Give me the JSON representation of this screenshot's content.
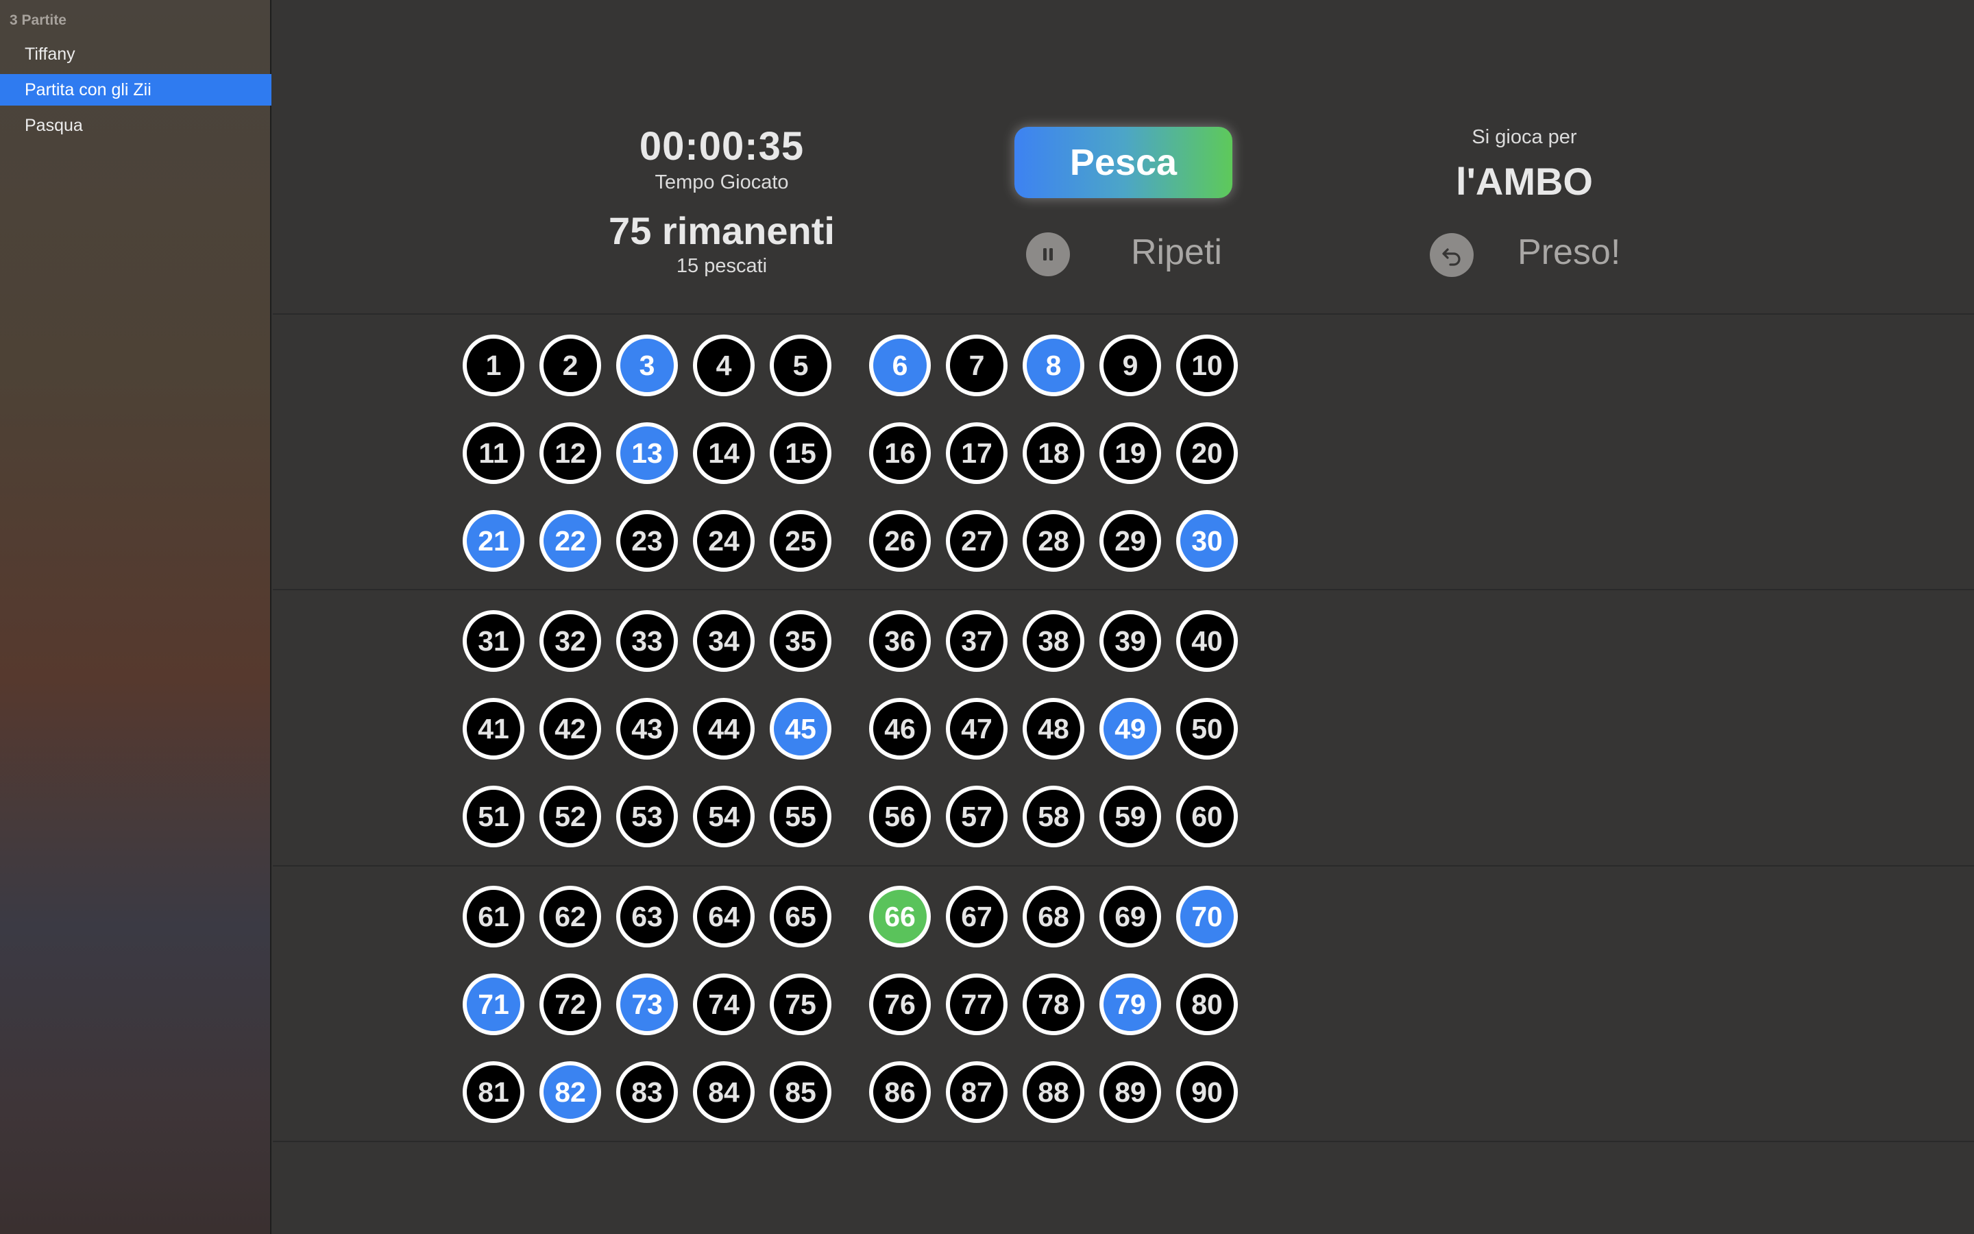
{
  "sidebar": {
    "header": "3 Partite",
    "items": [
      {
        "label": "Tiffany",
        "selected": false
      },
      {
        "label": "Partita con gli Zii",
        "selected": true
      },
      {
        "label": "Pasqua",
        "selected": false
      }
    ]
  },
  "stats": {
    "time_played": "00:00:35",
    "time_label": "Tempo Giocato",
    "remaining": "75 rimanenti",
    "drawn": "15 pescati"
  },
  "controls": {
    "draw_label": "Pesca",
    "repeat_label": "Ripeti",
    "pause_icon": "pause-icon",
    "undo_icon": "undo-icon",
    "taken_label": "Preso!"
  },
  "goal": {
    "label": "Si gioca per",
    "value": "l'AMBO"
  },
  "board": {
    "numbers": [
      1,
      2,
      3,
      4,
      5,
      6,
      7,
      8,
      9,
      10,
      11,
      12,
      13,
      14,
      15,
      16,
      17,
      18,
      19,
      20,
      21,
      22,
      23,
      24,
      25,
      26,
      27,
      28,
      29,
      30,
      31,
      32,
      33,
      34,
      35,
      36,
      37,
      38,
      39,
      40,
      41,
      42,
      43,
      44,
      45,
      46,
      47,
      48,
      49,
      50,
      51,
      52,
      53,
      54,
      55,
      56,
      57,
      58,
      59,
      60,
      61,
      62,
      63,
      64,
      65,
      66,
      67,
      68,
      69,
      70,
      71,
      72,
      73,
      74,
      75,
      76,
      77,
      78,
      79,
      80,
      81,
      82,
      83,
      84,
      85,
      86,
      87,
      88,
      89,
      90
    ],
    "drawn_numbers": [
      3,
      6,
      8,
      13,
      21,
      22,
      30,
      45,
      49,
      70,
      71,
      73,
      79,
      82
    ],
    "last_drawn": 66,
    "colors": {
      "drawn": "#3a83f1",
      "last": "#5ac35b",
      "undrawn": "#000000"
    }
  }
}
